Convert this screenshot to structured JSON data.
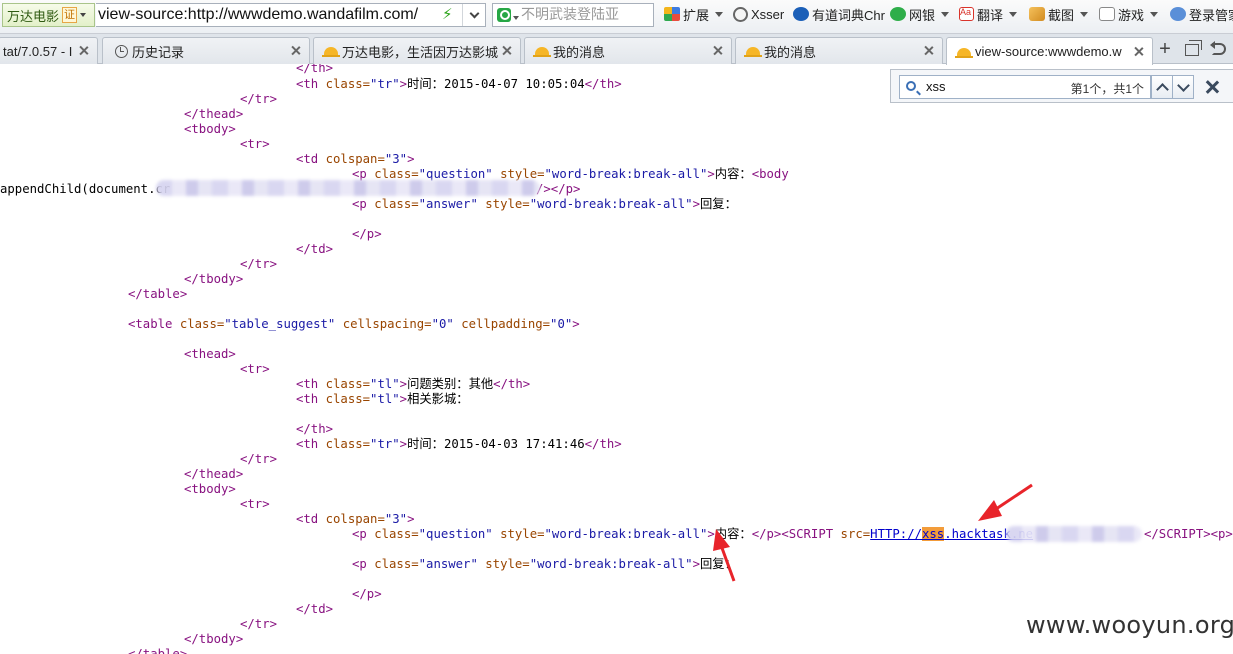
{
  "toolbar": {
    "site_name": "万达电影",
    "cert_label": "证",
    "url": "view-source:http://wwwdemo.wandafilm.com/",
    "search_placeholder": "不明武装登陆亚",
    "items": [
      {
        "label": "扩展",
        "icon": "extensions-icon"
      },
      {
        "label": "Xsser",
        "icon": "xsser-icon"
      },
      {
        "label": "有道词典Chr",
        "icon": "youdao-dict-icon"
      },
      {
        "label": "网银",
        "icon": "online-bank-icon"
      },
      {
        "label": "翻译",
        "icon": "translate-icon"
      },
      {
        "label": "截图",
        "icon": "screenshot-icon"
      },
      {
        "label": "游戏",
        "icon": "games-icon"
      },
      {
        "label": "登录管家",
        "icon": "login-manager-icon"
      }
    ]
  },
  "tabs": [
    {
      "label": "tat/7.0.57 - I",
      "icon": "none"
    },
    {
      "label": "历史记录",
      "icon": "history-icon"
    },
    {
      "label": "万达电影，生活因万达影城",
      "icon": "sun-icon"
    },
    {
      "label": "我的消息",
      "icon": "sun-icon"
    },
    {
      "label": "我的消息",
      "icon": "sun-icon"
    },
    {
      "label": "view-source:wwwdemo.w",
      "icon": "sun-icon",
      "active": true
    }
  ],
  "find": {
    "query": "xss",
    "count": "第1个，共1个"
  },
  "source": {
    "l1": "</th>",
    "l2_time": "时间：2015-04-07 10:05:04",
    "content_label": "内容：",
    "reply_label": "回复：",
    "append_fragment": "appendChild(document.cr",
    "suggest_table": {
      "class": "table_suggest",
      "cellspacing": "0",
      "cellpadding": "0"
    },
    "category": "问题类别：其他",
    "cinema": "相关影城：",
    "l2_time_b": "时间：2015-04-03 17:41:46",
    "script_src_prefix": "HTTP://",
    "script_src_host_match": "xss",
    "script_src_host_rest": ".hacktask.ne"
  },
  "watermark": "www.wooyun.org",
  "colors": {
    "tag": "#881280",
    "attr": "#994500",
    "value": "#1a1aa6",
    "highlight": "#f39c3a",
    "arrow": "#e8242a"
  }
}
